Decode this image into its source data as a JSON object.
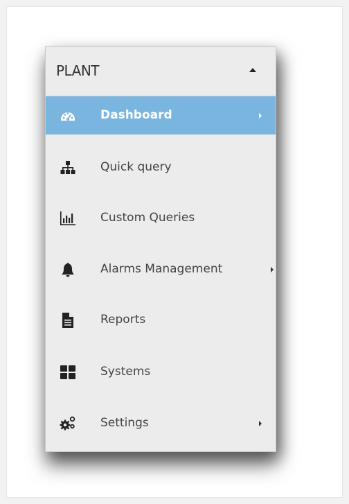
{
  "menu": {
    "title": "PLANT",
    "items": [
      {
        "label": "Dashboard",
        "icon": "dashboard-gauge-icon",
        "active": true,
        "has_submenu": true
      },
      {
        "label": "Quick query",
        "icon": "sitemap-icon",
        "active": false,
        "has_submenu": false
      },
      {
        "label": "Custom Queries",
        "icon": "bar-chart-icon",
        "active": false,
        "has_submenu": false
      },
      {
        "label": "Alarms Management",
        "icon": "bell-icon",
        "active": false,
        "has_submenu": true
      },
      {
        "label": "Reports",
        "icon": "document-icon",
        "active": false,
        "has_submenu": false
      },
      {
        "label": "Systems",
        "icon": "grid-icon",
        "active": false,
        "has_submenu": false
      },
      {
        "label": "Settings",
        "icon": "cogs-icon",
        "active": false,
        "has_submenu": true
      }
    ]
  },
  "colors": {
    "active_bg": "#7ab5e0",
    "menu_bg": "#ececec",
    "text": "#444444"
  }
}
